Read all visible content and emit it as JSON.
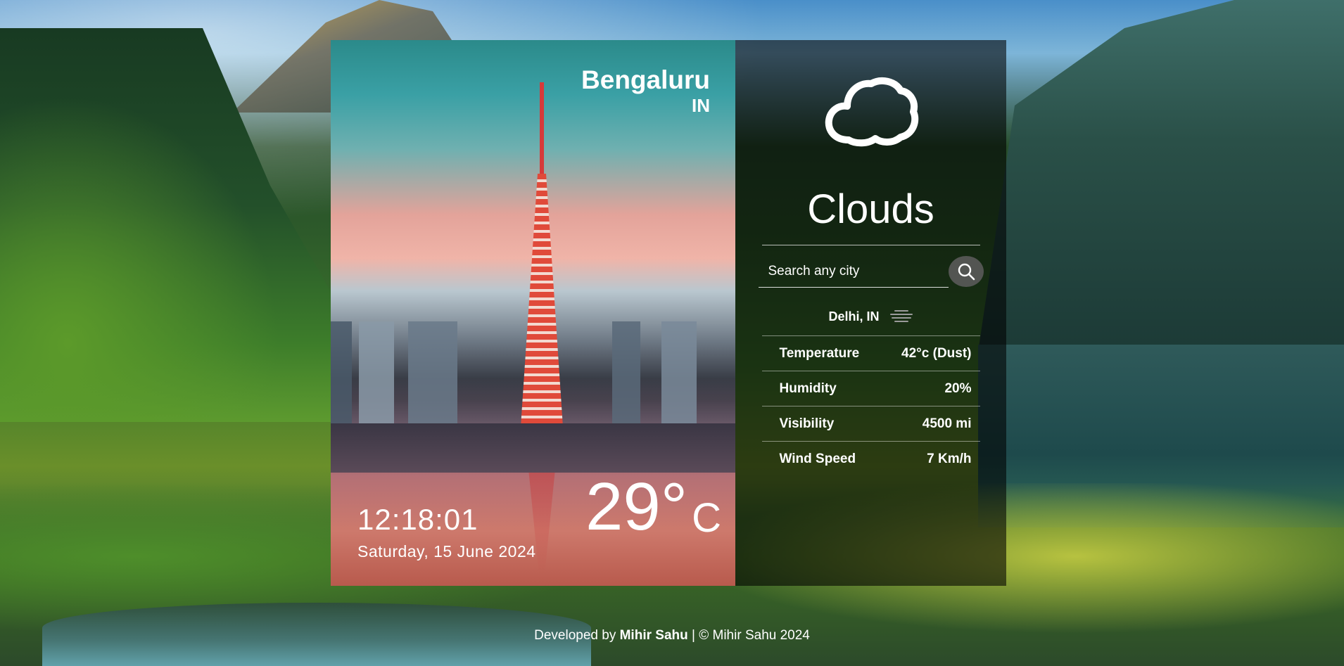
{
  "location": {
    "city": "Bengaluru",
    "country": "IN"
  },
  "clock": {
    "time": "12:18:01",
    "date": "Saturday, 15 June 2024"
  },
  "temperature": {
    "value": "29°",
    "unit": "C"
  },
  "weather": {
    "condition": "Clouds",
    "icon": "cloud-icon"
  },
  "search": {
    "placeholder": "Search any city",
    "value": ""
  },
  "current_location": {
    "label": "Delhi, IN",
    "icon": "haze-icon"
  },
  "stats": [
    {
      "label": "Temperature",
      "value": "42°c (Dust)"
    },
    {
      "label": "Humidity",
      "value": "20%"
    },
    {
      "label": "Visibility",
      "value": "4500 mi"
    },
    {
      "label": "Wind Speed",
      "value": "7 Km/h"
    }
  ],
  "footer": {
    "prefix": "Developed by",
    "author": "Mihir Sahu",
    "suffix": "| © Mihir Sahu 2024"
  },
  "colors": {
    "panel_overlay": "#000000",
    "text": "#ffffff",
    "search_button": "#5a5a5a"
  }
}
